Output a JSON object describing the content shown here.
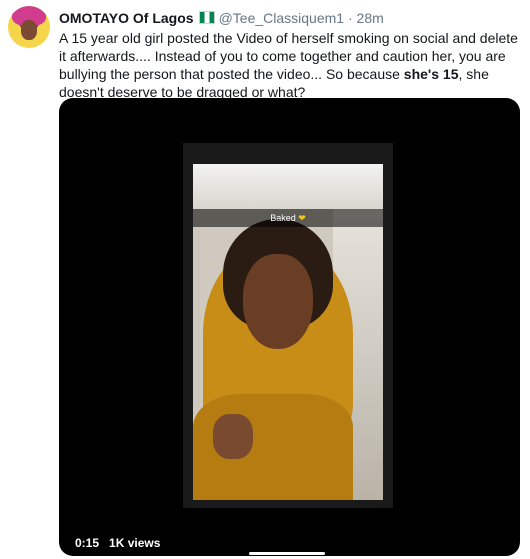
{
  "tweet": {
    "author_name": "OMOTAYO Of Lagos",
    "handle": "@Tee_Classiquem1",
    "separator": "·",
    "time_ago": "28m",
    "text_part1": "A 15 year old girl posted the Video of herself smoking on social and delete it afterwards.... Instead of you to come together and caution her, you are bullying the person that posted the video... So because ",
    "text_bold": "she's 15",
    "text_part2": ", she doesn't deserve to be dragged or what?"
  },
  "video": {
    "overlay_caption": "Baked",
    "elapsed_time": "0:15",
    "views": "1K views",
    "progress_fraction": 0.03
  },
  "icons": {
    "avatar": "profile-avatar",
    "flag": "nigeria-flag-icon"
  },
  "colors": {
    "name": "#14171a",
    "meta": "#657786",
    "video_bg": "#000000",
    "flag_green": "#008751"
  }
}
